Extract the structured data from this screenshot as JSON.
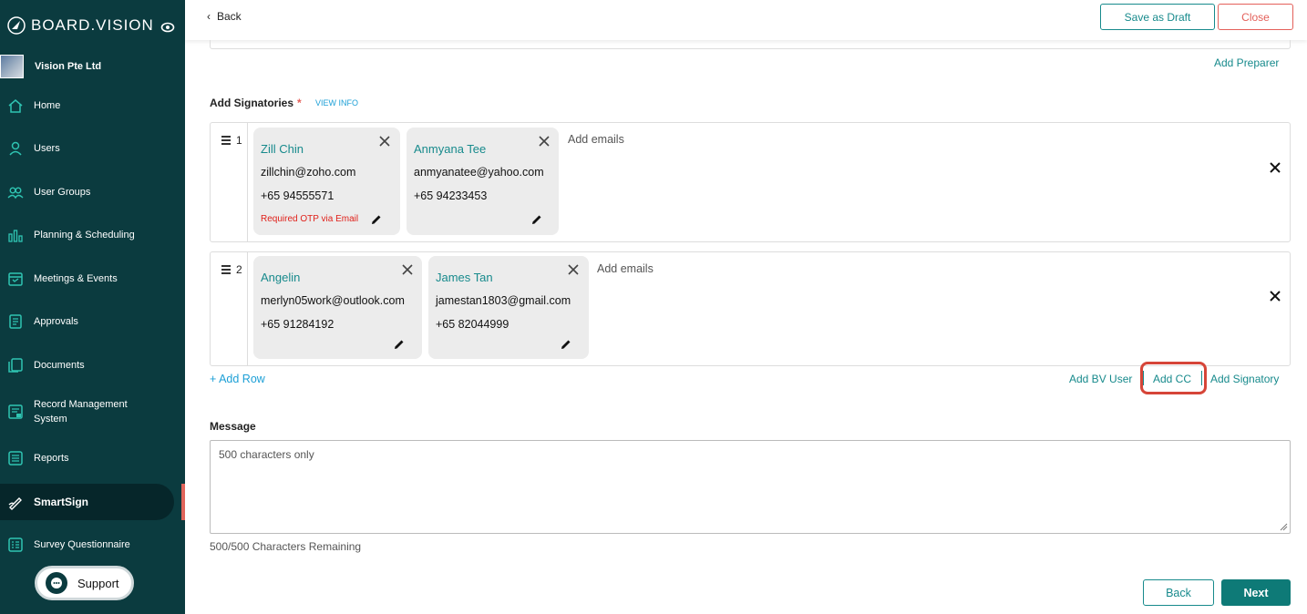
{
  "sidebar": {
    "brand": "BOARD.VISION",
    "org_name": "Vision Pte Ltd",
    "items": [
      {
        "label": "Home",
        "icon": "home-icon"
      },
      {
        "label": "Users",
        "icon": "user-icon"
      },
      {
        "label": "User Groups",
        "icon": "users-icon"
      },
      {
        "label": "Planning & Scheduling",
        "icon": "chart-icon"
      },
      {
        "label": "Meetings & Events",
        "icon": "calendar-icon"
      },
      {
        "label": "Approvals",
        "icon": "document-icon"
      },
      {
        "label": "Documents",
        "icon": "documents-icon"
      },
      {
        "label": "Record Management System",
        "icon": "record-icon"
      },
      {
        "label": "Reports",
        "icon": "report-icon"
      },
      {
        "label": "SmartSign",
        "icon": "pen-icon"
      },
      {
        "label": "Survey Questionnaire",
        "icon": "survey-icon"
      }
    ],
    "support_label": "Support"
  },
  "header": {
    "back_label": "Back",
    "save_draft_label": "Save as Draft",
    "close_label": "Close"
  },
  "form": {
    "add_preparer_label": "Add Preparer",
    "signatories_title": "Add Signatories",
    "required_mark": "*",
    "view_info_label": "VIEW INFO",
    "rows": [
      {
        "number": "1",
        "add_emails_placeholder": "Add emails",
        "signers": [
          {
            "name": "Zill Chin",
            "email": "zillchin@zoho.com",
            "phone": "+65 94555571",
            "note": "Required OTP via Email"
          },
          {
            "name": "Anmyana Tee",
            "email": "anmyanatee@yahoo.com",
            "phone": "+65 94233453",
            "note": ""
          }
        ]
      },
      {
        "number": "2",
        "add_emails_placeholder": "Add emails",
        "signers": [
          {
            "name": "Angelin",
            "email": "merlyn05work@outlook.com",
            "phone": "+65 91284192",
            "note": ""
          },
          {
            "name": "James Tan",
            "email": "jamestan1803@gmail.com",
            "phone": "+65 82044999",
            "note": ""
          }
        ]
      }
    ],
    "add_row_label": "+ Add Row",
    "add_bv_user_label": "Add BV User",
    "add_cc_label": "Add CC",
    "add_signatory_label": "Add Signatory",
    "message_title": "Message",
    "message_placeholder": "500 characters only",
    "remaining_text": "500/500 Characters Remaining",
    "back_button_label": "Back",
    "next_button_label": "Next"
  },
  "colors": {
    "sidebar_bg": "#0b3b3f",
    "accent_teal": "#178a8c",
    "close_red": "#e4605a",
    "highlight_red": "#d64538",
    "link_blue": "#1c9fd6"
  }
}
